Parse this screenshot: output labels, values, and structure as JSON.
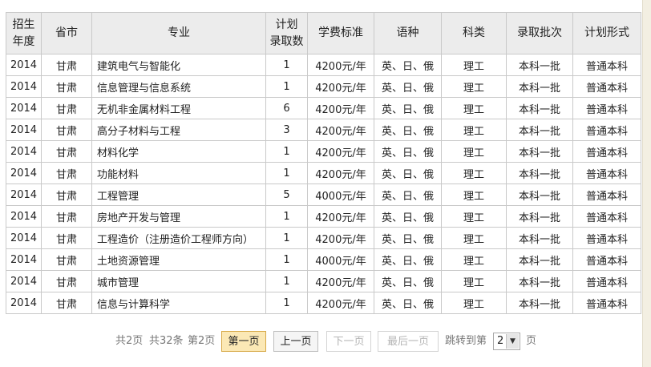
{
  "table": {
    "headers": [
      "招生\n年度",
      "省市",
      "专业",
      "计划\n录取数",
      "学费标准",
      "语种",
      "科类",
      "录取批次",
      "计划形式"
    ],
    "rows": [
      [
        "2014",
        "甘肃",
        "建筑电气与智能化",
        "1",
        "4200元/年",
        "英、日、俄",
        "理工",
        "本科一批",
        "普通本科"
      ],
      [
        "2014",
        "甘肃",
        "信息管理与信息系统",
        "1",
        "4200元/年",
        "英、日、俄",
        "理工",
        "本科一批",
        "普通本科"
      ],
      [
        "2014",
        "甘肃",
        "无机非金属材料工程",
        "6",
        "4200元/年",
        "英、日、俄",
        "理工",
        "本科一批",
        "普通本科"
      ],
      [
        "2014",
        "甘肃",
        "高分子材料与工程",
        "3",
        "4200元/年",
        "英、日、俄",
        "理工",
        "本科一批",
        "普通本科"
      ],
      [
        "2014",
        "甘肃",
        "材料化学",
        "1",
        "4200元/年",
        "英、日、俄",
        "理工",
        "本科一批",
        "普通本科"
      ],
      [
        "2014",
        "甘肃",
        "功能材料",
        "1",
        "4200元/年",
        "英、日、俄",
        "理工",
        "本科一批",
        "普通本科"
      ],
      [
        "2014",
        "甘肃",
        "工程管理",
        "5",
        "4000元/年",
        "英、日、俄",
        "理工",
        "本科一批",
        "普通本科"
      ],
      [
        "2014",
        "甘肃",
        "房地产开发与管理",
        "1",
        "4200元/年",
        "英、日、俄",
        "理工",
        "本科一批",
        "普通本科"
      ],
      [
        "2014",
        "甘肃",
        "工程造价（注册造价工程师方向）",
        "1",
        "4200元/年",
        "英、日、俄",
        "理工",
        "本科一批",
        "普通本科"
      ],
      [
        "2014",
        "甘肃",
        "土地资源管理",
        "1",
        "4000元/年",
        "英、日、俄",
        "理工",
        "本科一批",
        "普通本科"
      ],
      [
        "2014",
        "甘肃",
        "城市管理",
        "1",
        "4200元/年",
        "英、日、俄",
        "理工",
        "本科一批",
        "普通本科"
      ],
      [
        "2014",
        "甘肃",
        "信息与计算科学",
        "1",
        "4200元/年",
        "英、日、俄",
        "理工",
        "本科一批",
        "普通本科"
      ]
    ]
  },
  "pager": {
    "total_pages": "共2页",
    "total_items": "共32条",
    "current_page": "第2页",
    "first_label": "第一页",
    "prev_label": "上一页",
    "next_label": "下一页",
    "last_label": "最后一页",
    "jump_label": "跳转到第",
    "page_value": "2",
    "page_suffix": "页"
  },
  "colors": {
    "header_bg": "#ececec",
    "border": "#c9c9c9",
    "active_button_bg": "#fbe8b5",
    "active_button_border": "#d7a846",
    "disabled_text": "#b5b5b5"
  }
}
